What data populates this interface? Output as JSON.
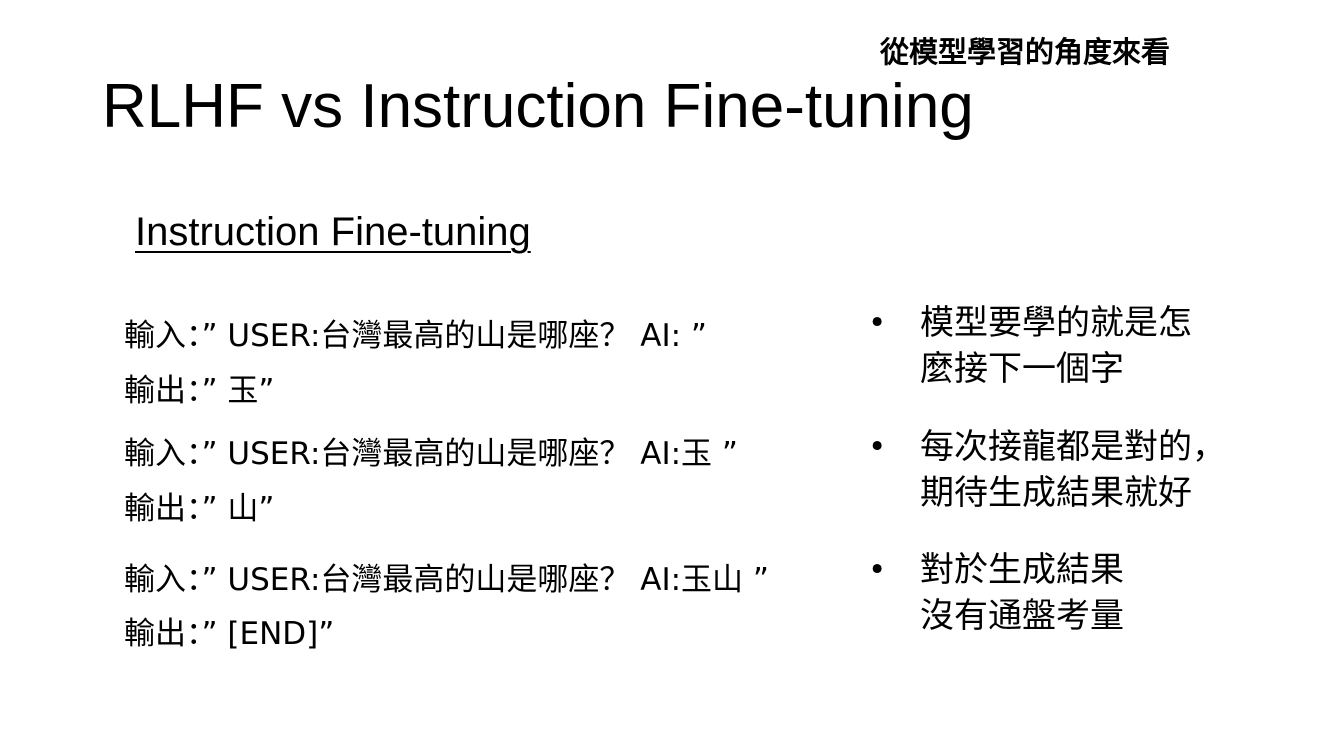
{
  "slide": {
    "corner_note": "從模型學習的角度來看",
    "title": "RLHF vs Instruction Fine-tuning",
    "section_heading": "Instruction Fine-tuning"
  },
  "examples": [
    {
      "input": "輸入：” USER:台灣最高的山是哪座？ AI: ”",
      "output": "輸出：” 玉”"
    },
    {
      "input": "輸入：” USER:台灣最高的山是哪座？ AI:玉 ”",
      "output": "輸出：” 山”"
    },
    {
      "input": "輸入：” USER:台灣最高的山是哪座？ AI:玉山 ”",
      "output": "輸出：” [END]”"
    }
  ],
  "bullets": [
    {
      "marker": "•",
      "lines": [
        "模型要學的就是怎",
        "麼接下一個字"
      ]
    },
    {
      "marker": "•",
      "lines": [
        "每次接龍都是對的，",
        "期待生成結果就好"
      ]
    },
    {
      "marker": "•",
      "lines": [
        "對於生成結果",
        "沒有通盤考量"
      ]
    }
  ]
}
